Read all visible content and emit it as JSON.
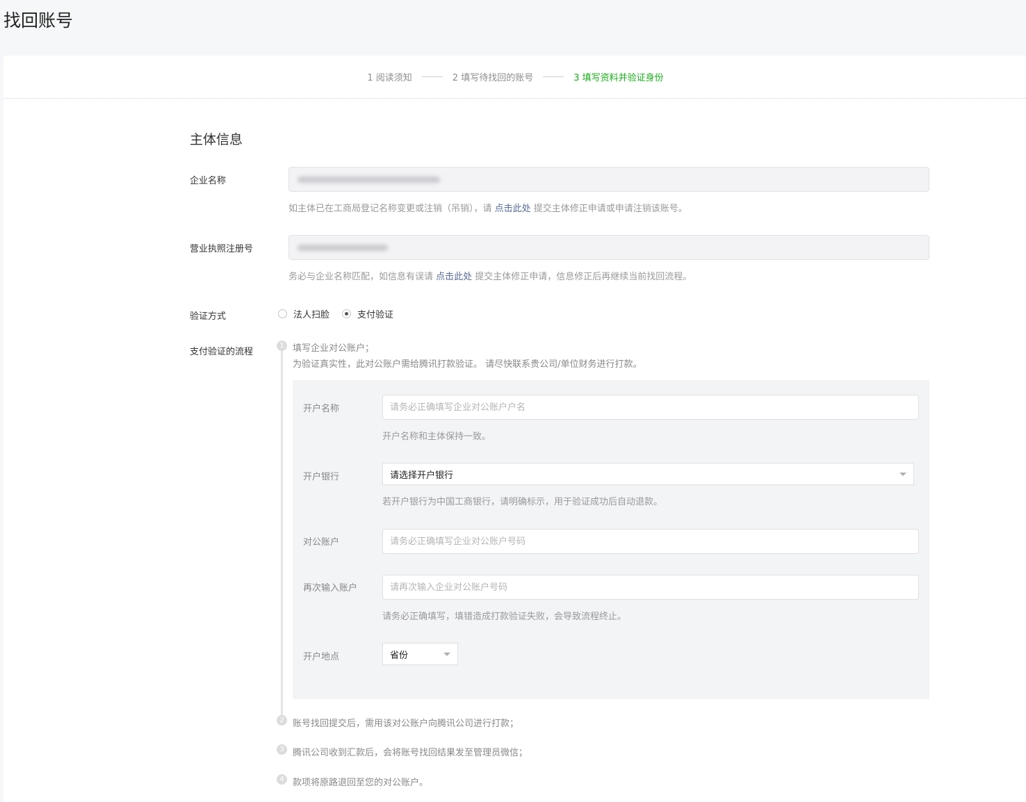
{
  "page": {
    "title": "找回账号"
  },
  "steps": [
    {
      "label": "1 阅读须知",
      "active": false
    },
    {
      "label": "2 填写待找回的账号",
      "active": false
    },
    {
      "label": "3 填写资料并验证身份",
      "active": true
    }
  ],
  "colors": {
    "accent": "#1aad19",
    "link": "#576b95"
  },
  "section": {
    "title": "主体信息"
  },
  "company": {
    "label": "企业名称",
    "tip_before": "如主体已在工商局登记名称变更或注销（吊销），请 ",
    "tip_link": "点击此处",
    "tip_after": " 提交主体修正申请或申请注销该账号。"
  },
  "license": {
    "label": "营业执照注册号",
    "tip_before": "务必与企业名称匹配，如信息有误请 ",
    "tip_link": "点击此处",
    "tip_after": " 提交主体修正申请，信息修正后再继续当前找回流程。"
  },
  "verify": {
    "label": "验证方式",
    "options": [
      {
        "label": "法人扫脸",
        "checked": false
      },
      {
        "label": "支付验证",
        "checked": true
      }
    ]
  },
  "process": {
    "label": "支付验证的流程",
    "steps": [
      {
        "num": "1",
        "line1": "填写企业对公账户；",
        "line2": "为验证真实性，此对公账户需给腾讯打款验证。 请尽快联系贵公司/单位财务进行打款。"
      },
      {
        "num": "2",
        "text": "账号找回提交后，需用该对公账户向腾讯公司进行打款；"
      },
      {
        "num": "3",
        "text": "腾讯公司收到汇款后，会将账号找回结果发至管理员微信；"
      },
      {
        "num": "4",
        "text": "款项将原路退回至您的对公账户。"
      }
    ]
  },
  "form": {
    "account_name": {
      "label": "开户名称",
      "placeholder": "请务必正确填写企业对公账户户名",
      "value": "",
      "tip": "开户名称和主体保持一致。"
    },
    "bank": {
      "label": "开户银行",
      "selected": "请选择开户银行",
      "tip": "若开户银行为中国工商银行，请明确标示，用于验证成功后自动退款。"
    },
    "account_no": {
      "label": "对公账户",
      "placeholder": "请务必正确填写企业对公账户号码",
      "value": ""
    },
    "account_no_confirm": {
      "label": "再次输入账户",
      "placeholder": "请再次输入企业对公账户号码",
      "value": "",
      "tip": "请务必正确填写，填错造成打款验证失败，会导致流程终止。"
    },
    "location": {
      "label": "开户地点",
      "selected": "省份"
    }
  }
}
